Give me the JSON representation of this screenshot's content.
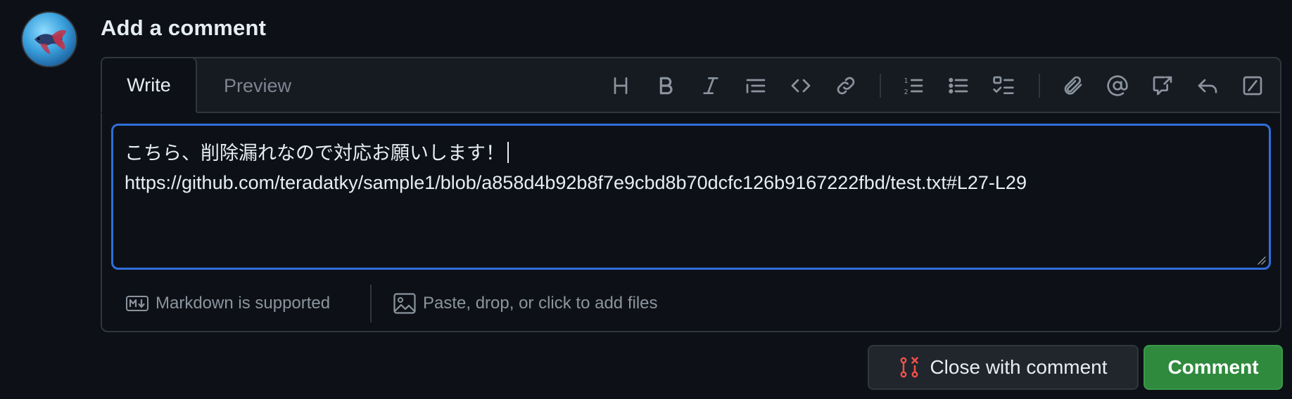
{
  "header": {
    "title": "Add a comment"
  },
  "avatar": {
    "description_icon": "betta-fish-avatar"
  },
  "tabs": [
    {
      "label": "Write",
      "active": true
    },
    {
      "label": "Preview",
      "active": false
    }
  ],
  "toolbar": {
    "icons": [
      "heading-icon",
      "bold-icon",
      "italic-icon",
      "quote-icon",
      "code-icon",
      "link-icon",
      "ordered-list-icon",
      "unordered-list-icon",
      "task-list-icon",
      "attach-icon",
      "mention-icon",
      "cross-reference-icon",
      "reply-icon",
      "slash-command-icon"
    ]
  },
  "editor": {
    "line1": "こちら、削除漏れなので対応お願いします！",
    "line2": "https://github.com/teradatky/sample1/blob/a858d4b92b8f7e9cbd8b70dcfc126b9167222fbd/test.txt#L27-L29"
  },
  "footer": {
    "markdown_label": "Markdown is supported",
    "files_label": "Paste, drop, or click to add files"
  },
  "actions": {
    "close_label": "Close with comment",
    "comment_label": "Comment"
  },
  "colors": {
    "background": "#0d1117",
    "focus_border": "#2f6fdb",
    "comment_button": "#2f8a3e",
    "close_icon": "#f85149"
  }
}
